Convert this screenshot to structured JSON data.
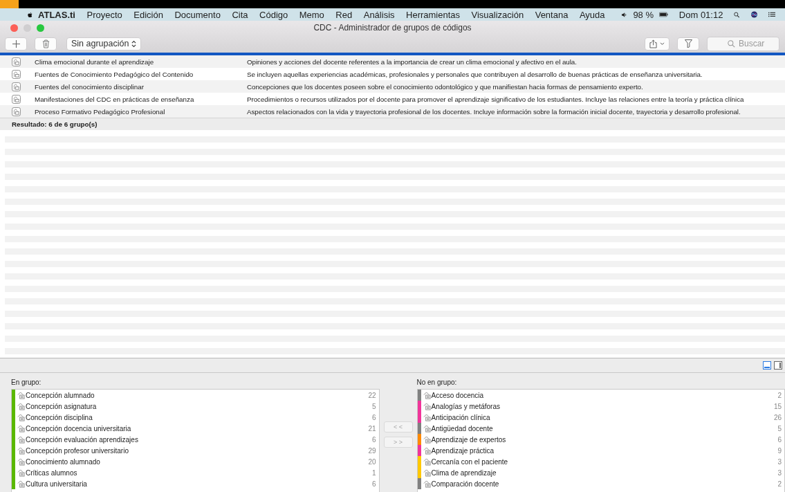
{
  "menu_bar": {
    "app": "ATLAS.ti",
    "items": [
      "Proyecto",
      "Edición",
      "Documento",
      "Cita",
      "Código",
      "Memo",
      "Red",
      "Análisis",
      "Herramientas",
      "Visualización",
      "Ventana",
      "Ayuda"
    ],
    "battery": "98 %",
    "clock": "Dom 01:12"
  },
  "window": {
    "title": "CDC - Administrador de grupos de códigos"
  },
  "toolbar": {
    "grouping": "Sin agrupación",
    "search": {
      "placeholder": "Buscar"
    }
  },
  "groups": [
    {
      "name": "Clima emocional durante el aprendizaje",
      "description": "Opiniones y acciones del docente referentes a la importancia de crear un clima emocional y afectivo en el aula."
    },
    {
      "name": "Fuentes de Conocimiento Pedagógico del Contenido",
      "description": "Se incluyen aquellas experiencias académicas, profesionales y personales que contribuyen al desarrollo de buenas prácticas de enseñanza universitaria."
    },
    {
      "name": "Fuentes del conocimiento disciplinar",
      "description": "Concepciones que los docentes poseen sobre el conocimiento odontológico y que manifiestan hacia formas de pensamiento experto."
    },
    {
      "name": "Manifestaciones del CDC en prácticas de enseñanza",
      "description": "Procedimientos o recursos utilizados por el docente para promover el aprendizaje significativo de los estudiantes. Incluye las relaciones entre la teoría y práctica clínica"
    },
    {
      "name": "Proceso Formativo Pedagógico Profesional",
      "description": "Aspectos relacionados con la vida y trayectoria profesional de los docentes. Incluye información sobre la formación inicial docente, trayectoria y desarrollo profesional."
    }
  ],
  "result": "Resultado: 6 de 6 grupo(s)",
  "in_group": {
    "label": "En grupo:",
    "codes": [
      {
        "name": "Concepción alumnado",
        "count": "22",
        "color": "#5bb800"
      },
      {
        "name": "Concepción asignatura",
        "count": "5",
        "color": "#5bb800"
      },
      {
        "name": "Concepción disciplina",
        "count": "6",
        "color": "#5bb800"
      },
      {
        "name": "Concepción docencia universitaria",
        "count": "21",
        "color": "#5bb800"
      },
      {
        "name": "Concepción evaluación aprendizajes",
        "count": "6",
        "color": "#5bb800"
      },
      {
        "name": "Concepción profesor universitario",
        "count": "29",
        "color": "#5bb800"
      },
      {
        "name": "Conocimiento alumnado",
        "count": "20",
        "color": "#5bb800"
      },
      {
        "name": "Críticas alumnos",
        "count": "1",
        "color": "#5bb800"
      },
      {
        "name": "Cultura universitaria",
        "count": "6",
        "color": "#5bb800"
      }
    ]
  },
  "move_buttons": [
    "< <",
    "> >"
  ],
  "not_in_group": {
    "label": "No en grupo:",
    "codes": [
      {
        "name": "Acceso docencia",
        "count": "2",
        "color": "#808080"
      },
      {
        "name": "Analogías y metáforas",
        "count": "15",
        "color": "#f0359a"
      },
      {
        "name": "Anticipación clínica",
        "count": "26",
        "color": "#f0359a"
      },
      {
        "name": "Antigüedad docente",
        "count": "5",
        "color": "#808080"
      },
      {
        "name": "Aprendizaje de expertos",
        "count": "6",
        "color": "#ff8a00"
      },
      {
        "name": "Aprendizaje práctica",
        "count": "9",
        "color": "#f0359a"
      },
      {
        "name": "Cercanía con el paciente",
        "count": "3",
        "color": "#ffc800"
      },
      {
        "name": "Clima de aprendizaje",
        "count": "3",
        "color": "#ffc800"
      },
      {
        "name": "Comparación docente",
        "count": "2",
        "color": "#808080"
      }
    ]
  }
}
